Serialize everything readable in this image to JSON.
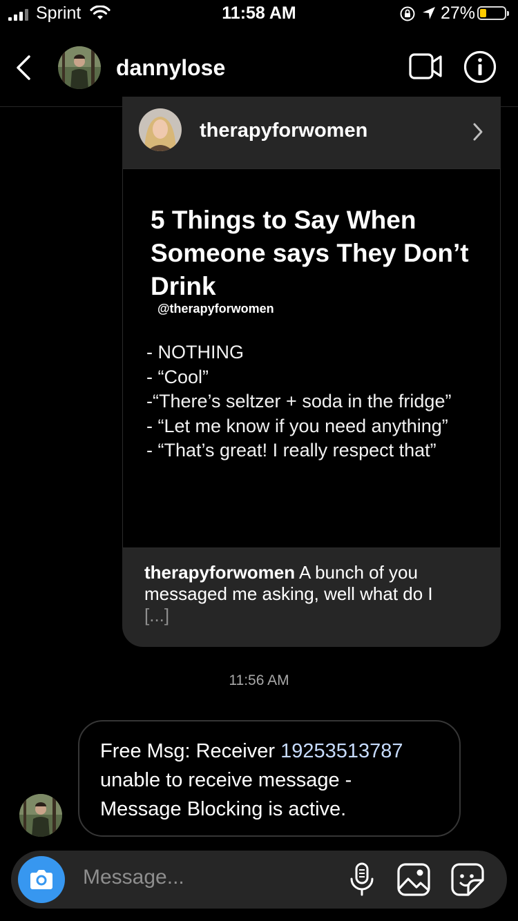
{
  "status_bar": {
    "carrier": "Sprint",
    "time": "11:58 AM",
    "battery_percent": "27%",
    "battery_level": 0.27,
    "battery_color": "#ffcc00"
  },
  "header": {
    "username": "dannylose"
  },
  "shared_post": {
    "author": "therapyforwomen",
    "image": {
      "title": "5 Things to Say When Someone says They Don’t Drink",
      "handle": "@therapyforwomen",
      "items": [
        "- NOTHING",
        "- “Cool”",
        "-“There’s seltzer + soda in the fridge”",
        "- “Let me know if you need anything”",
        "- “That’s great! I really respect that”"
      ]
    },
    "caption_author": "therapyforwomen",
    "caption_text": "A bunch of you messaged me asking, well what do I",
    "caption_more": "[...]"
  },
  "timestamp": "11:56 AM",
  "message": {
    "text_before": "Free Msg: Receiver ",
    "phone": "19253513787",
    "text_after": " unable to receive message - Message Blocking is active."
  },
  "composer": {
    "placeholder": "Message..."
  },
  "colors": {
    "accent_blue": "#3797f0",
    "bubble_border": "#363636",
    "card_bg": "#262626"
  }
}
